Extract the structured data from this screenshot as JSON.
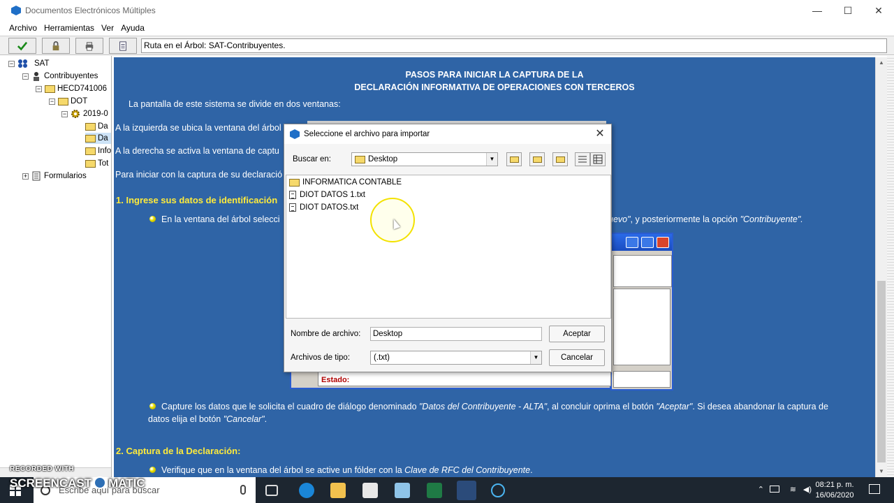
{
  "window": {
    "title": "Documentos Electrónicos Múltiples",
    "controls": [
      "—",
      "☐",
      "✕"
    ]
  },
  "menu": [
    "Archivo",
    "Herramientas",
    "Ver",
    "Ayuda"
  ],
  "toolbar": {
    "route_text": "Ruta en el Árbol: SAT-Contribuyentes."
  },
  "tree": {
    "nodes": [
      {
        "label": "SAT"
      },
      {
        "label": "Contribuyentes"
      },
      {
        "label": "HECD741006"
      },
      {
        "label": "DOT"
      },
      {
        "label": "2019-0"
      },
      {
        "label": "Da"
      },
      {
        "label": "Da"
      },
      {
        "label": "Info"
      },
      {
        "label": "Tot"
      },
      {
        "label": "Formularios"
      }
    ]
  },
  "content": {
    "heading_1": "PASOS PARA INICIAR LA CAPTURA DE LA",
    "heading_2": "DECLARACIÓN INFORMATIVA DE OPERACIONES CON TERCEROS",
    "p1": "La pantalla de este sistema se divide en dos ventanas:",
    "p2": "A la izquierda se ubica la ventana del árbol",
    "p3": "A la derecha se activa la ventana de captu",
    "p4": "Para iniciar con la captura de su declaració",
    "section1": "1. Ingrese sus datos de identificación",
    "b1_left": "En la ventana del árbol selecci",
    "b1_right_a": "uevo\"",
    "b1_right_b": ", y posteriormente la opción ",
    "b1_right_c": "\"Contribuyente\".",
    "b2_a": "Capture los datos que le solicita el cuadro de diálogo denominado ",
    "b2_b": "\"Datos del Contribuyente - ALTA\"",
    "b2_c": ", al concluir oprima el botón ",
    "b2_d": "\"Aceptar\"",
    "b2_e": ". Si desea abandonar la captura de",
    "b2_f": "datos elija el botón ",
    "b2_g": "\"Cancelar\"",
    "b2_h": ".",
    "section2": "2. Captura de la Declaración:",
    "b3_a": "Verifique que en la ventana del árbol se active un fólder con la ",
    "b3_b": "Clave de RFC del Contribuyente",
    "b3_c": "."
  },
  "bg_dialog": {
    "status_label": "Estado:"
  },
  "dialog": {
    "title": "Seleccione el archivo para importar",
    "look_in_label": "Buscar en:",
    "look_in_value": "Desktop",
    "files": [
      {
        "name": "INFORMATICA CONTABLE",
        "type": "folder"
      },
      {
        "name": "DIOT DATOS 1.txt",
        "type": "file"
      },
      {
        "name": "DIOT DATOS.txt",
        "type": "file"
      }
    ],
    "filename_label": "Nombre de archivo:",
    "filename_value": "Desktop",
    "filetype_label": "Archivos de tipo:",
    "filetype_value": "(.txt)",
    "accept": "Aceptar",
    "cancel": "Cancelar"
  },
  "taskbar": {
    "search_placeholder": "Escribe aquí para buscar",
    "time": "08:21 p. m.",
    "date": "16/06/2020"
  },
  "watermark": {
    "recorded": "RECORDED WITH",
    "brand_a": "SCREENCAST",
    "brand_b": "MATIC"
  },
  "colors": {
    "content_bg": "#2f64a6",
    "section_heading": "#ffeb3b",
    "accent": "#1f6fc7"
  }
}
